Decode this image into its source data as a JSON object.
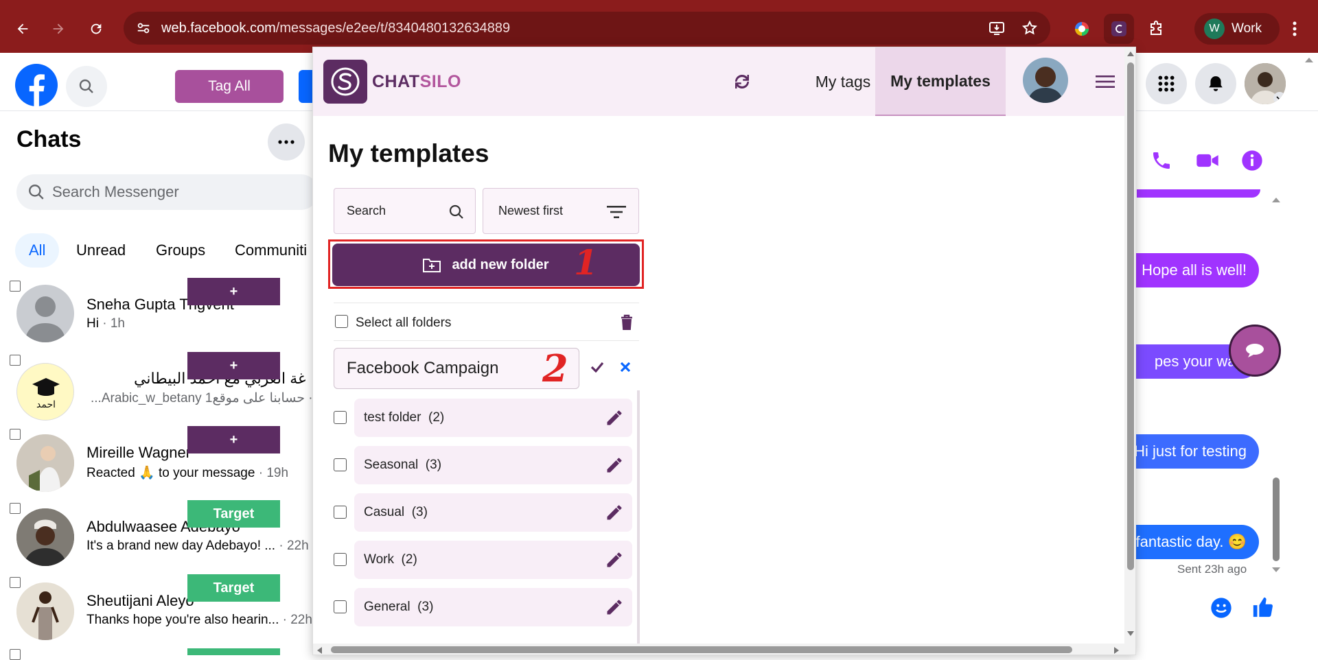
{
  "browser": {
    "url_host": "web.facebook.com",
    "url_path": "/messages/e2ee/t/8340480132634889",
    "profile_initial": "W",
    "profile_label": "Work"
  },
  "facebook": {
    "tag_all_label": "Tag All",
    "chats_title": "Chats",
    "search_placeholder": "Search Messenger",
    "filter_tabs": [
      "All",
      "Unread",
      "Groups",
      "Communiti"
    ],
    "chats": [
      {
        "name": "Sneha Gupta Tngvent",
        "preview": "Hi",
        "time": " · 1h",
        "tag": "+"
      },
      {
        "name": "غة العربي مع احمد البيطاني",
        "preview": "...Arabic_w_betany حسابنا على موقع",
        "time": "1 · ",
        "tag": "+"
      },
      {
        "name": "Mireille Wagner",
        "preview": "Reacted 🙏 to your message",
        "time": " · 19h",
        "tag": "+"
      },
      {
        "name": "Abdulwaasee Adebayo",
        "preview": "It's a brand new day Adebayo! ...",
        "time": " · 22h",
        "tag": "Target"
      },
      {
        "name": "Sheutijani Aleyo",
        "preview": "Thanks hope you're also hearin...",
        "time": " · 22h",
        "tag": "Target"
      }
    ]
  },
  "conversation": {
    "messages": [
      "Hope all is well!",
      "pes your way.",
      "Hi just for testing",
      "fantastic day. 😊"
    ],
    "sent_status": "Sent 23h ago"
  },
  "chatsilo": {
    "brand_part1": "CHAT",
    "brand_part2": "SILO",
    "tab_my_tags": "My tags",
    "tab_my_templates": "My templates",
    "page_title": "My templates",
    "search_placeholder": "Search",
    "sort_label": "Newest first",
    "add_folder_label": "add new folder",
    "select_all_label": "Select all folders",
    "new_folder_value": "Facebook Campaign",
    "folders": [
      {
        "name": "test folder",
        "count": "(2)"
      },
      {
        "name": "Seasonal",
        "count": "(3)"
      },
      {
        "name": "Casual",
        "count": "(3)"
      },
      {
        "name": "Work",
        "count": "(2)"
      },
      {
        "name": "General",
        "count": "(3)"
      }
    ],
    "annotation_1": "1",
    "annotation_2": "2"
  },
  "colors": {
    "chrome_bar": "#8b1c1c",
    "chatsilo_primary": "#5c2c62",
    "chatsilo_accent": "#b2569d",
    "messenger_purple": "#a033ff",
    "annotation_red": "#e12424",
    "tag_plus": "#5c2c62",
    "tag_target": "#3cb878"
  },
  "icons": [
    "back-icon",
    "forward-icon",
    "reload-icon",
    "site-settings-icon",
    "install-icon",
    "star-icon",
    "extension-icon",
    "menu-kebab-icon",
    "facebook-logo-icon",
    "search-icon",
    "grid-icon",
    "bell-icon",
    "refresh-icon",
    "hamburger-icon",
    "filter-icon",
    "folder-plus-icon",
    "trash-icon",
    "check-icon",
    "close-icon",
    "pencil-icon",
    "phone-icon",
    "video-icon",
    "info-icon",
    "emoji-icon",
    "thumbs-up-icon",
    "chat-bubble-icon"
  ]
}
